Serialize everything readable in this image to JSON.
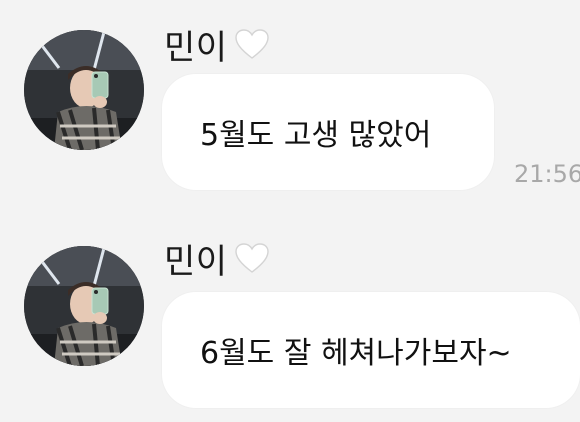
{
  "messages": [
    {
      "sender": "민이",
      "text": "5월도 고생 많았어",
      "time": "21:56"
    },
    {
      "sender": "민이",
      "text": "6월도 잘 헤쳐나가보자~"
    }
  ],
  "icons": {
    "heart": "white-heart-icon",
    "avatar": "avatar"
  },
  "colors": {
    "background": "#f3f3f3",
    "bubble": "#ffffff",
    "timestamp": "#a8a8a8"
  }
}
